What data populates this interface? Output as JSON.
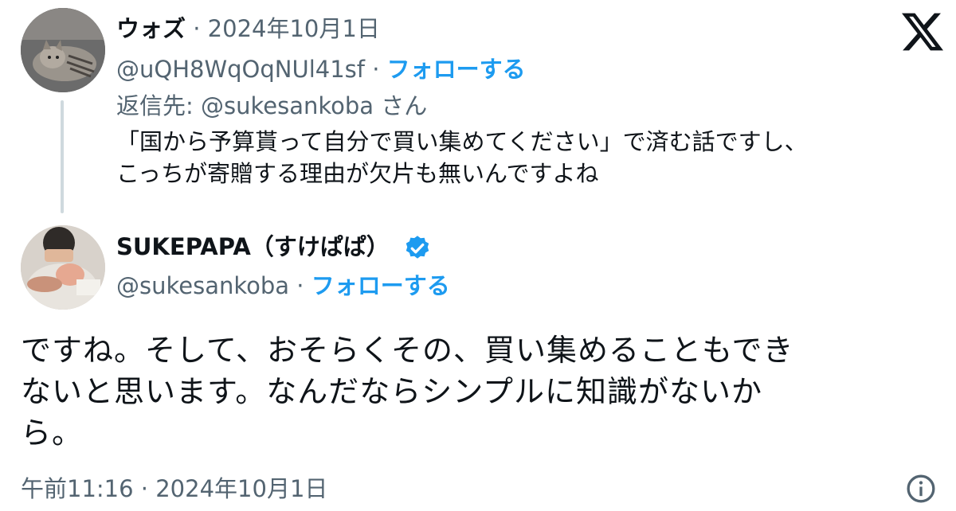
{
  "reply_tweet": {
    "author_name": "ウォズ",
    "separator": "·",
    "date": "2024年10月1日",
    "handle": "@uQH8WqOqNUl41sf",
    "follow_label": "フォローする",
    "reply_prefix": "返信先: ",
    "reply_to": "@sukesankoba",
    "reply_suffix": "さん",
    "text_line1": "「国から予算貰って自分で買い集めてください」で済む話ですし、",
    "text_line2": "こっちが寄贈する理由が欠片も無いんですよね"
  },
  "main_tweet": {
    "author_name": "SUKEPAPA（すけぱぱ）",
    "handle": "@sukesankoba",
    "separator": "·",
    "follow_label": "フォローする",
    "text_line1": "ですね。そして、おそらくその、買い集めることもでき",
    "text_line2": "ないと思います。なんだならシンプルに知識がないか",
    "text_line3": "ら。",
    "time": "午前11:16",
    "date": "2024年10月1日"
  },
  "icons": {
    "brand": "x-logo-icon",
    "verified": "verified-badge-icon",
    "info": "info-icon"
  },
  "colors": {
    "accent": "#1d9bf0",
    "muted": "#536471",
    "text": "#0f1419",
    "thread_line": "#cfd9de"
  }
}
